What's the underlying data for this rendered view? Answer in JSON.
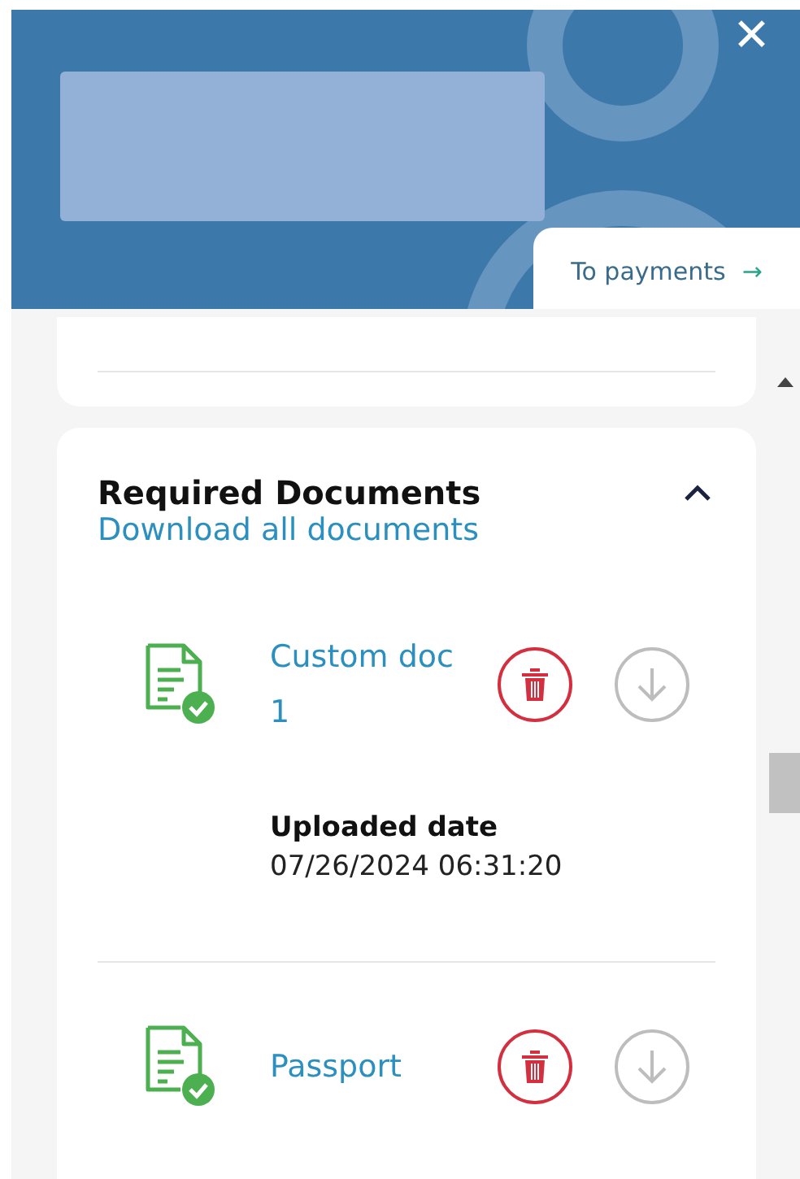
{
  "header": {
    "close": "✕",
    "tab": {
      "label": "To payments",
      "arrow": "→"
    }
  },
  "section": {
    "title": "Required Documents",
    "expanded": true,
    "download_all": "Download all documents",
    "documents": [
      {
        "name": "Custom doc 1",
        "uploaded_label": "Uploaded date",
        "uploaded_date": "07/26/2024 06:31:20"
      },
      {
        "name": "Passport"
      }
    ]
  }
}
